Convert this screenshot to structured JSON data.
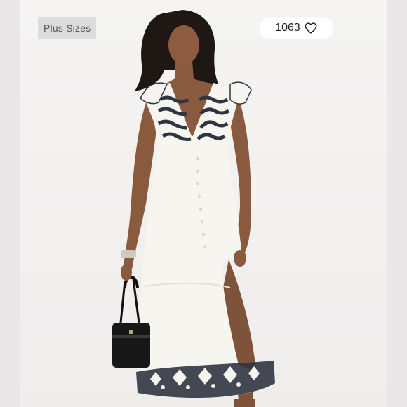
{
  "badge": {
    "label": "Plus Sizes"
  },
  "likes": {
    "count": "1063",
    "icon": "heart-outline-icon"
  },
  "colors": {
    "page_bg": "#e6e4e5",
    "card_bg": "#f4f3f2",
    "badge_bg": "#dcdcdc",
    "dress": "#f7f5ef",
    "embroidery": "#2f3540"
  }
}
